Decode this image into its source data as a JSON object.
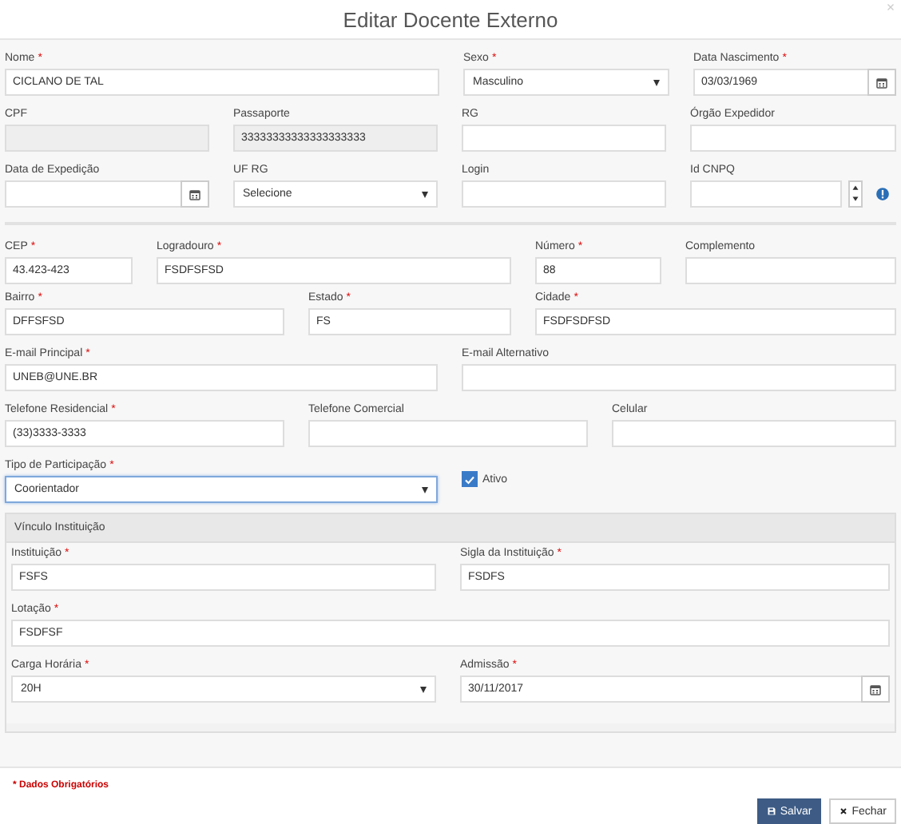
{
  "window": {
    "title": "Editar Docente Externo"
  },
  "form": {
    "groups": [
      [
        [
          {
            "label": "Nome",
            "required_mark": "*",
            "kind": "text",
            "value": "CICLANO DE TAL"
          },
          {
            "label": "Sexo",
            "required_mark": "*",
            "kind": "select",
            "value": "Masculino"
          },
          {
            "label": "Data Nascimento",
            "required_mark": "*",
            "kind": "date",
            "value": "03/03/1969"
          }
        ],
        [
          {
            "label": "CPF",
            "kind": "text",
            "disabled": true
          },
          {
            "label": "Passaporte",
            "kind": "text",
            "disabled": true,
            "value": "33333333333333333333"
          },
          {
            "label": "RG",
            "kind": "text"
          },
          {
            "label": "Órgão Expedidor",
            "kind": "text"
          }
        ],
        [
          {
            "label": "Data de Expedição",
            "kind": "date"
          },
          {
            "label": "UF RG",
            "kind": "select",
            "value": "Selecione"
          },
          {
            "label": "Login",
            "kind": "text"
          },
          {
            "label": "Id CNPQ",
            "kind": "number",
            "help_icon": true
          }
        ]
      ],
      [
        [
          {
            "label": "CEP",
            "required_mark": "*",
            "kind": "text",
            "value": "43.423-423"
          },
          {
            "label": "Logradouro",
            "required_mark": "*",
            "kind": "text",
            "value": "FSDFSFSD"
          },
          {
            "label": "Número",
            "required_mark": "*",
            "kind": "text",
            "value": "88"
          },
          {
            "label": "Complemento",
            "kind": "text"
          }
        ],
        [
          {
            "label": "Bairro",
            "required_mark": "*",
            "kind": "text",
            "value": "DFFSFSD"
          },
          {
            "label": "Estado",
            "required_mark": "*",
            "kind": "text",
            "value": "FS"
          },
          {
            "label": "Cidade",
            "required_mark": "*",
            "kind": "text",
            "value": "FSDFSDFSD"
          }
        ],
        [
          {
            "label": "E-mail Principal",
            "required_mark": "*",
            "kind": "text",
            "value": "UNEB@UNE.BR"
          },
          {
            "label": "E-mail Alternativo",
            "kind": "text"
          }
        ],
        [
          {
            "label": "Telefone Residencial",
            "required_mark": "*",
            "kind": "text",
            "value": "(33)3333-3333"
          },
          {
            "label": "Telefone Comercial",
            "kind": "text"
          },
          {
            "label": "Celular",
            "kind": "text"
          }
        ],
        [
          {
            "label": "Tipo de Participação",
            "required_mark": "*",
            "kind": "select",
            "value": "Coorientador",
            "focused": true
          },
          {
            "label": "Ativo",
            "kind": "checkbox",
            "checked": true
          }
        ]
      ]
    ]
  },
  "panel": {
    "title": "Vínculo Instituição",
    "rows": [
      [
        {
          "label": "Instituição",
          "required_mark": "*",
          "kind": "text",
          "value": "FSFS"
        },
        {
          "label": "Sigla da Instituição",
          "required_mark": "*",
          "kind": "text",
          "value": "FSDFS"
        }
      ],
      [
        {
          "label": "Lotação",
          "required_mark": "*",
          "kind": "text",
          "value": "FSDFSF"
        }
      ],
      [
        {
          "label": "Carga Horária",
          "required_mark": "*",
          "kind": "select",
          "value": "20H"
        },
        {
          "label": "Admissão",
          "required_mark": "*",
          "kind": "date",
          "value": "30/11/2017"
        }
      ]
    ]
  },
  "footer": {
    "note": "* Dados Obrigatórios",
    "buttons": [
      {
        "label": "Salvar",
        "kind": "primary"
      },
      {
        "label": "Fechar",
        "kind": "default"
      }
    ]
  }
}
